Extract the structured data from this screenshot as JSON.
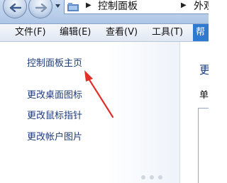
{
  "address_bar": {
    "segments": [
      "控制面板",
      "外观和个性化"
    ]
  },
  "menu": {
    "file": "文件(F)",
    "edit": "编辑(E)",
    "view": "查看(V)",
    "tools": "工具(T)",
    "help": "帮"
  },
  "left_pane": {
    "links": {
      "home": "控制面板主页",
      "desktop_icons": "更改桌面图标",
      "mouse_pointers": "更改鼠标指针",
      "account_picture": "更改帐户图片"
    }
  },
  "right_pane": {
    "heading": "更",
    "label": "单"
  },
  "colors": {
    "link": "#1f3d7a",
    "annotation_arrow": "#e0302a",
    "menu_highlight": "#2f7ad1"
  },
  "icons": {
    "back": "back-arrow-icon",
    "forward": "forward-arrow-icon",
    "folder": "control-panel-folder-icon",
    "separator": "breadcrumb-chevron-icon",
    "annotation": "red-annotation-arrow"
  }
}
